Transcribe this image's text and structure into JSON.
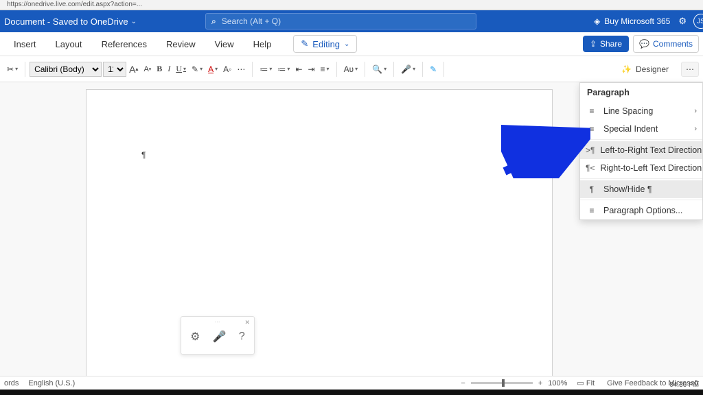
{
  "browser": {
    "url_hint": "https://onedrive.live.com/edit.aspx?action=..."
  },
  "title": {
    "doc": "Document",
    "saved": " - Saved to OneDrive",
    "search_placeholder": "Search (Alt + Q)",
    "buy": "Buy Microsoft 365",
    "avatar": "JS"
  },
  "tabs": {
    "items": [
      "Insert",
      "Layout",
      "References",
      "Review",
      "View",
      "Help"
    ],
    "editing": "Editing",
    "share": "Share",
    "comments": "Comments"
  },
  "ribbon": {
    "font_name": "Calibri (Body)",
    "font_size": "11",
    "designer": "Designer"
  },
  "panel": {
    "header": "Paragraph",
    "items": [
      {
        "icon": "≡",
        "label": "Line Spacing",
        "arrow": true
      },
      {
        "icon": "≡",
        "label": "Special Indent",
        "arrow": true
      },
      {
        "icon": ">¶",
        "label": "Left-to-Right Text Direction",
        "hl": true
      },
      {
        "icon": "¶<",
        "label": "Right-to-Left Text Direction"
      },
      {
        "icon": "¶",
        "label": "Show/Hide ¶",
        "hl": true
      },
      {
        "icon": "≡",
        "label": "Paragraph Options..."
      }
    ]
  },
  "dictate": {
    "gear": "⚙",
    "mic": "🎤",
    "help": "?"
  },
  "page": {
    "mark": "¶"
  },
  "status": {
    "left1": "ords",
    "left2": "English (U.S.)",
    "zoom_minus": "−",
    "zoom_plus": "+",
    "zoom_pct": "100%",
    "fit": "Fit",
    "feedback": "Give Feedback to Microsoft"
  },
  "clock": "04:36 PM"
}
